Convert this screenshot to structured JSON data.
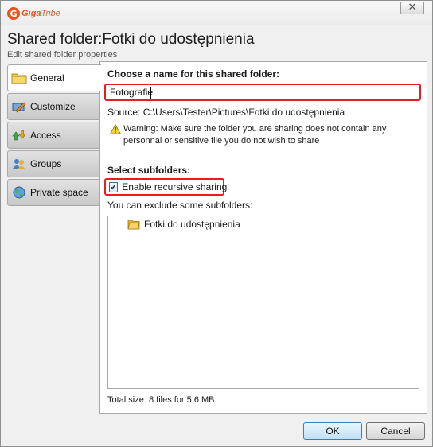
{
  "app": {
    "logo_letter": "G",
    "logo_name_part1": "Giga",
    "logo_name_part2": "Tribe",
    "close_glyph": "✕",
    "brand_color": "#e8541d"
  },
  "header": {
    "title": "Shared folder:Fotki do udostępnienia",
    "subtitle": "Edit shared folder properties"
  },
  "sidebar": {
    "items": [
      {
        "label": "General",
        "icon": "folder-icon",
        "active": true
      },
      {
        "label": "Customize",
        "icon": "brush-icon",
        "active": false
      },
      {
        "label": "Access",
        "icon": "access-arrows-icon",
        "active": false
      },
      {
        "label": "Groups",
        "icon": "groups-icon",
        "active": false
      },
      {
        "label": "Private space",
        "icon": "globe-icon",
        "active": false
      }
    ]
  },
  "general": {
    "name_label": "Choose a name for this shared folder:",
    "name_value": "Fotografie",
    "source_text": "Source: C:\\Users\\Tester\\Pictures\\Fotki do udostępnienia",
    "warning_text": "Warning: Make sure the folder you are sharing does not contain any personnal or sensitive file you do not wish to share",
    "subfolders_label": "Select subfolders:",
    "recursive_label": "Enable recursive sharing",
    "recursive_checked": true,
    "checkmark": "✔",
    "exclude_label": "You can exclude some subfolders:",
    "tree": [
      {
        "label": "Fotki do udostępnienia",
        "icon": "folder-icon"
      }
    ],
    "total_size": "Total size: 8 files for 5.6 MB.",
    "highlight_color": "#e31e24"
  },
  "buttons": {
    "ok": "OK",
    "cancel": "Cancel"
  }
}
